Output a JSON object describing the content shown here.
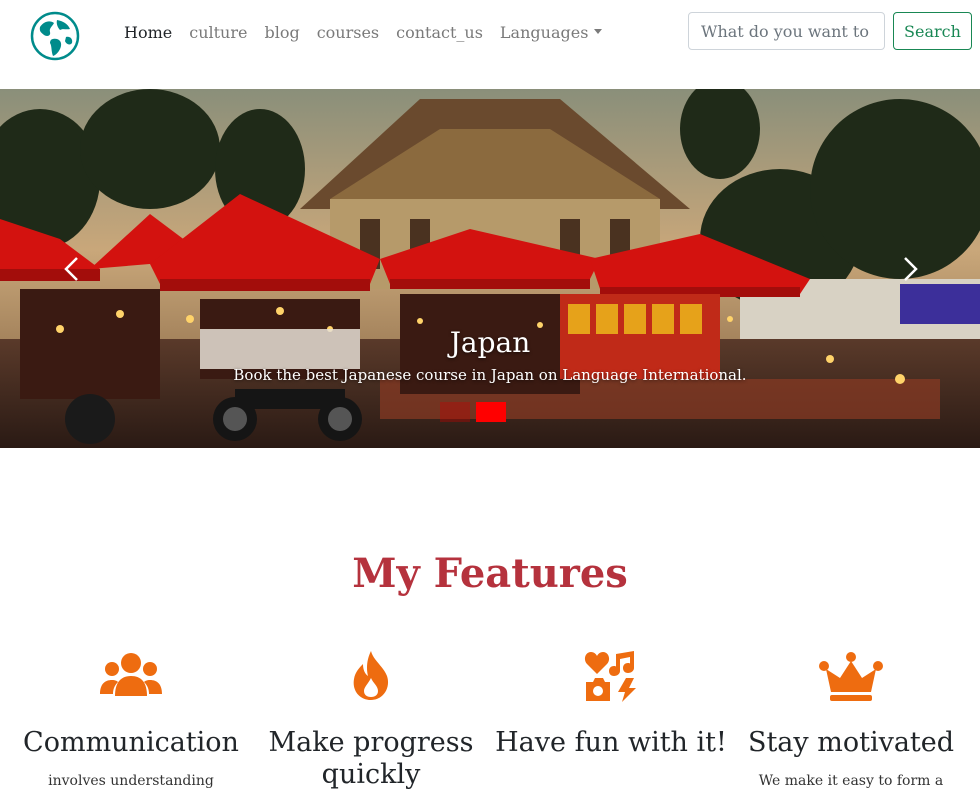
{
  "nav": {
    "links": [
      "Home",
      "culture",
      "blog",
      "courses",
      "contact_us",
      "Languages"
    ],
    "active": "Home"
  },
  "search": {
    "placeholder": "What do you want to",
    "button_label": "Search"
  },
  "carousel": {
    "caption_title": "Japan",
    "caption_text": "Book the best Japanese course in Japan on Language International.",
    "indicator_count": 2,
    "active_indicator": 1
  },
  "features": {
    "heading": "My Features",
    "items": [
      {
        "icon": "users-icon",
        "title": "Communication",
        "desc": "involves understanding"
      },
      {
        "icon": "fire-icon",
        "title": "Make progress quickly",
        "desc": ""
      },
      {
        "icon": "icons-icon",
        "title": "Have fun with it!",
        "desc": ""
      },
      {
        "icon": "crown-icon",
        "title": "Stay motivated",
        "desc": "We make it easy to form a"
      }
    ]
  },
  "colors": {
    "accent": "#b5323d",
    "icon_orange": "#ee6c10",
    "search_green": "#198754",
    "indicator_red": "#ff0000"
  }
}
